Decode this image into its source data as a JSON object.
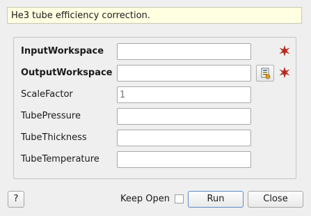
{
  "description": "He3 tube efficiency correction.",
  "properties": [
    {
      "label": "InputWorkspace",
      "value": "",
      "placeholder": "",
      "required": true,
      "bold": true,
      "browse": false
    },
    {
      "label": "OutputWorkspace",
      "value": "",
      "placeholder": "",
      "required": true,
      "bold": true,
      "browse": true
    },
    {
      "label": "ScaleFactor",
      "value": "",
      "placeholder": "1",
      "required": false,
      "bold": false,
      "browse": false
    },
    {
      "label": "TubePressure",
      "value": "",
      "placeholder": "",
      "required": false,
      "bold": false,
      "browse": false
    },
    {
      "label": "TubeThickness",
      "value": "",
      "placeholder": "",
      "required": false,
      "bold": false,
      "browse": false
    },
    {
      "label": "TubeTemperature",
      "value": "",
      "placeholder": "",
      "required": false,
      "bold": false,
      "browse": false
    }
  ],
  "footer": {
    "help_label": "?",
    "keep_open_label": "Keep Open",
    "keep_open_checked": false,
    "run_label": "Run",
    "close_label": "Close"
  },
  "colors": {
    "required_star": "#b52a1c",
    "description_bg": "#ffffe1"
  }
}
